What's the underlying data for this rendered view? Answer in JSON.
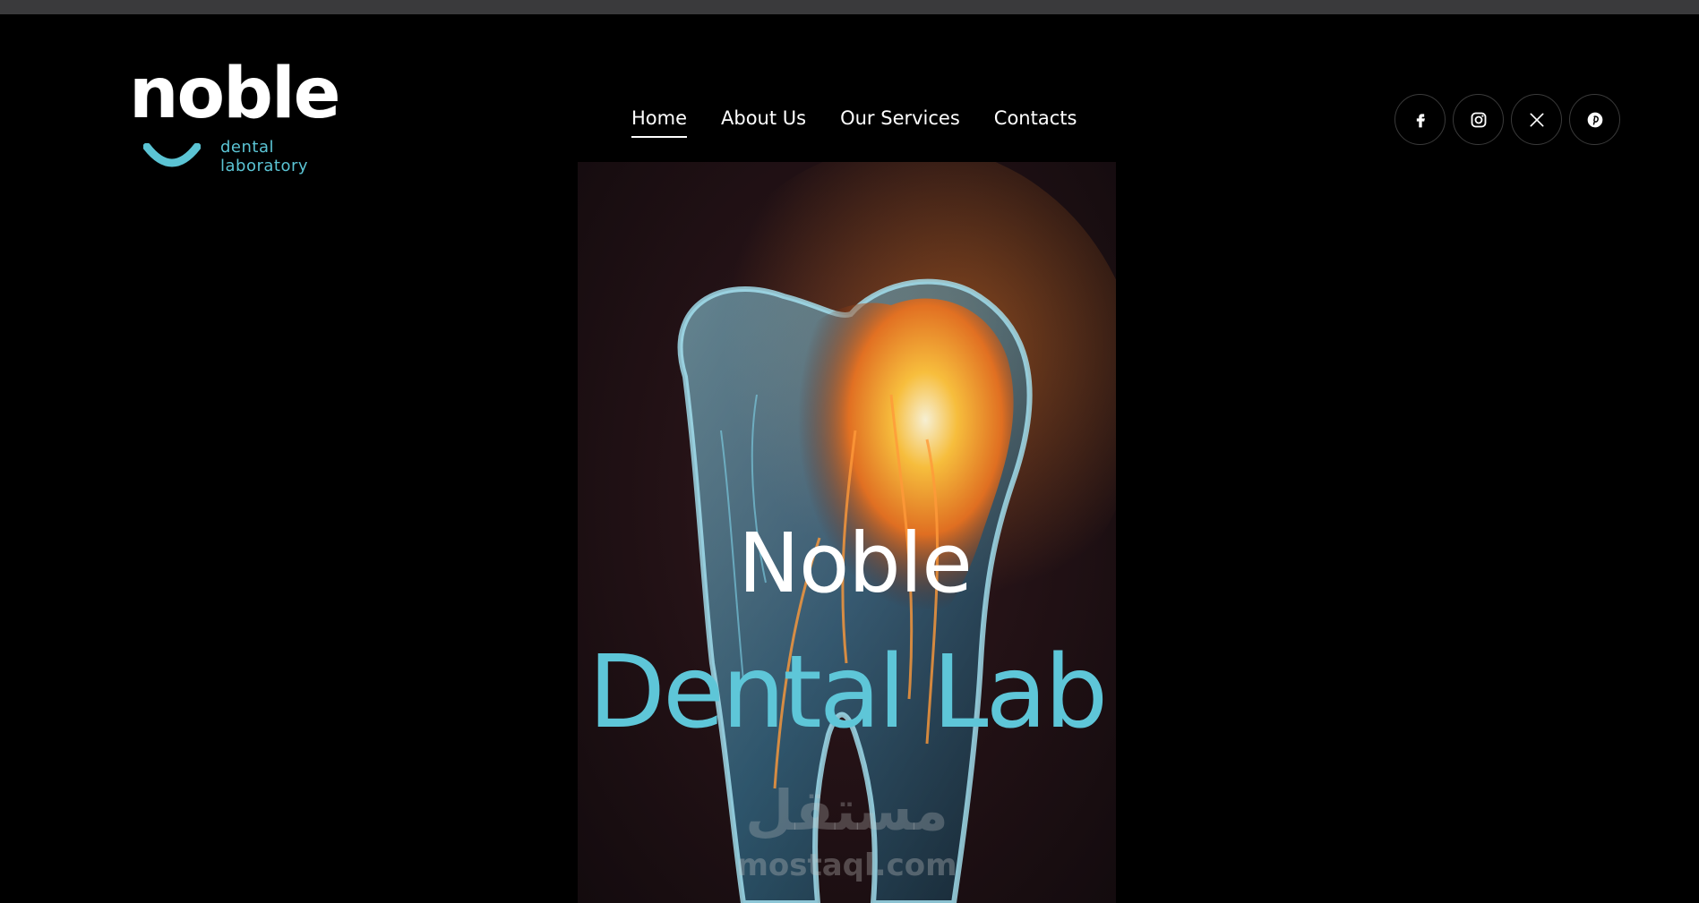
{
  "header": {
    "logo": {
      "word": "noble",
      "sub_line_1": "dental",
      "sub_line_2": "laboratory"
    },
    "nav": [
      {
        "label": "Home",
        "active": true
      },
      {
        "label": "About Us",
        "active": false
      },
      {
        "label": "Our Services",
        "active": false
      },
      {
        "label": "Contacts",
        "active": false
      }
    ],
    "socials": [
      {
        "icon": "facebook-icon"
      },
      {
        "icon": "instagram-icon"
      },
      {
        "icon": "x-twitter-icon"
      },
      {
        "icon": "pinterest-icon"
      }
    ]
  },
  "hero": {
    "title_line_1": "Noble",
    "title_line_2": "Dental Lab",
    "watermark_arabic": "مستقل",
    "watermark_latin": "mostaql.com"
  },
  "colors": {
    "background": "#000000",
    "accent": "#5ec6d8",
    "text": "#ffffff"
  }
}
